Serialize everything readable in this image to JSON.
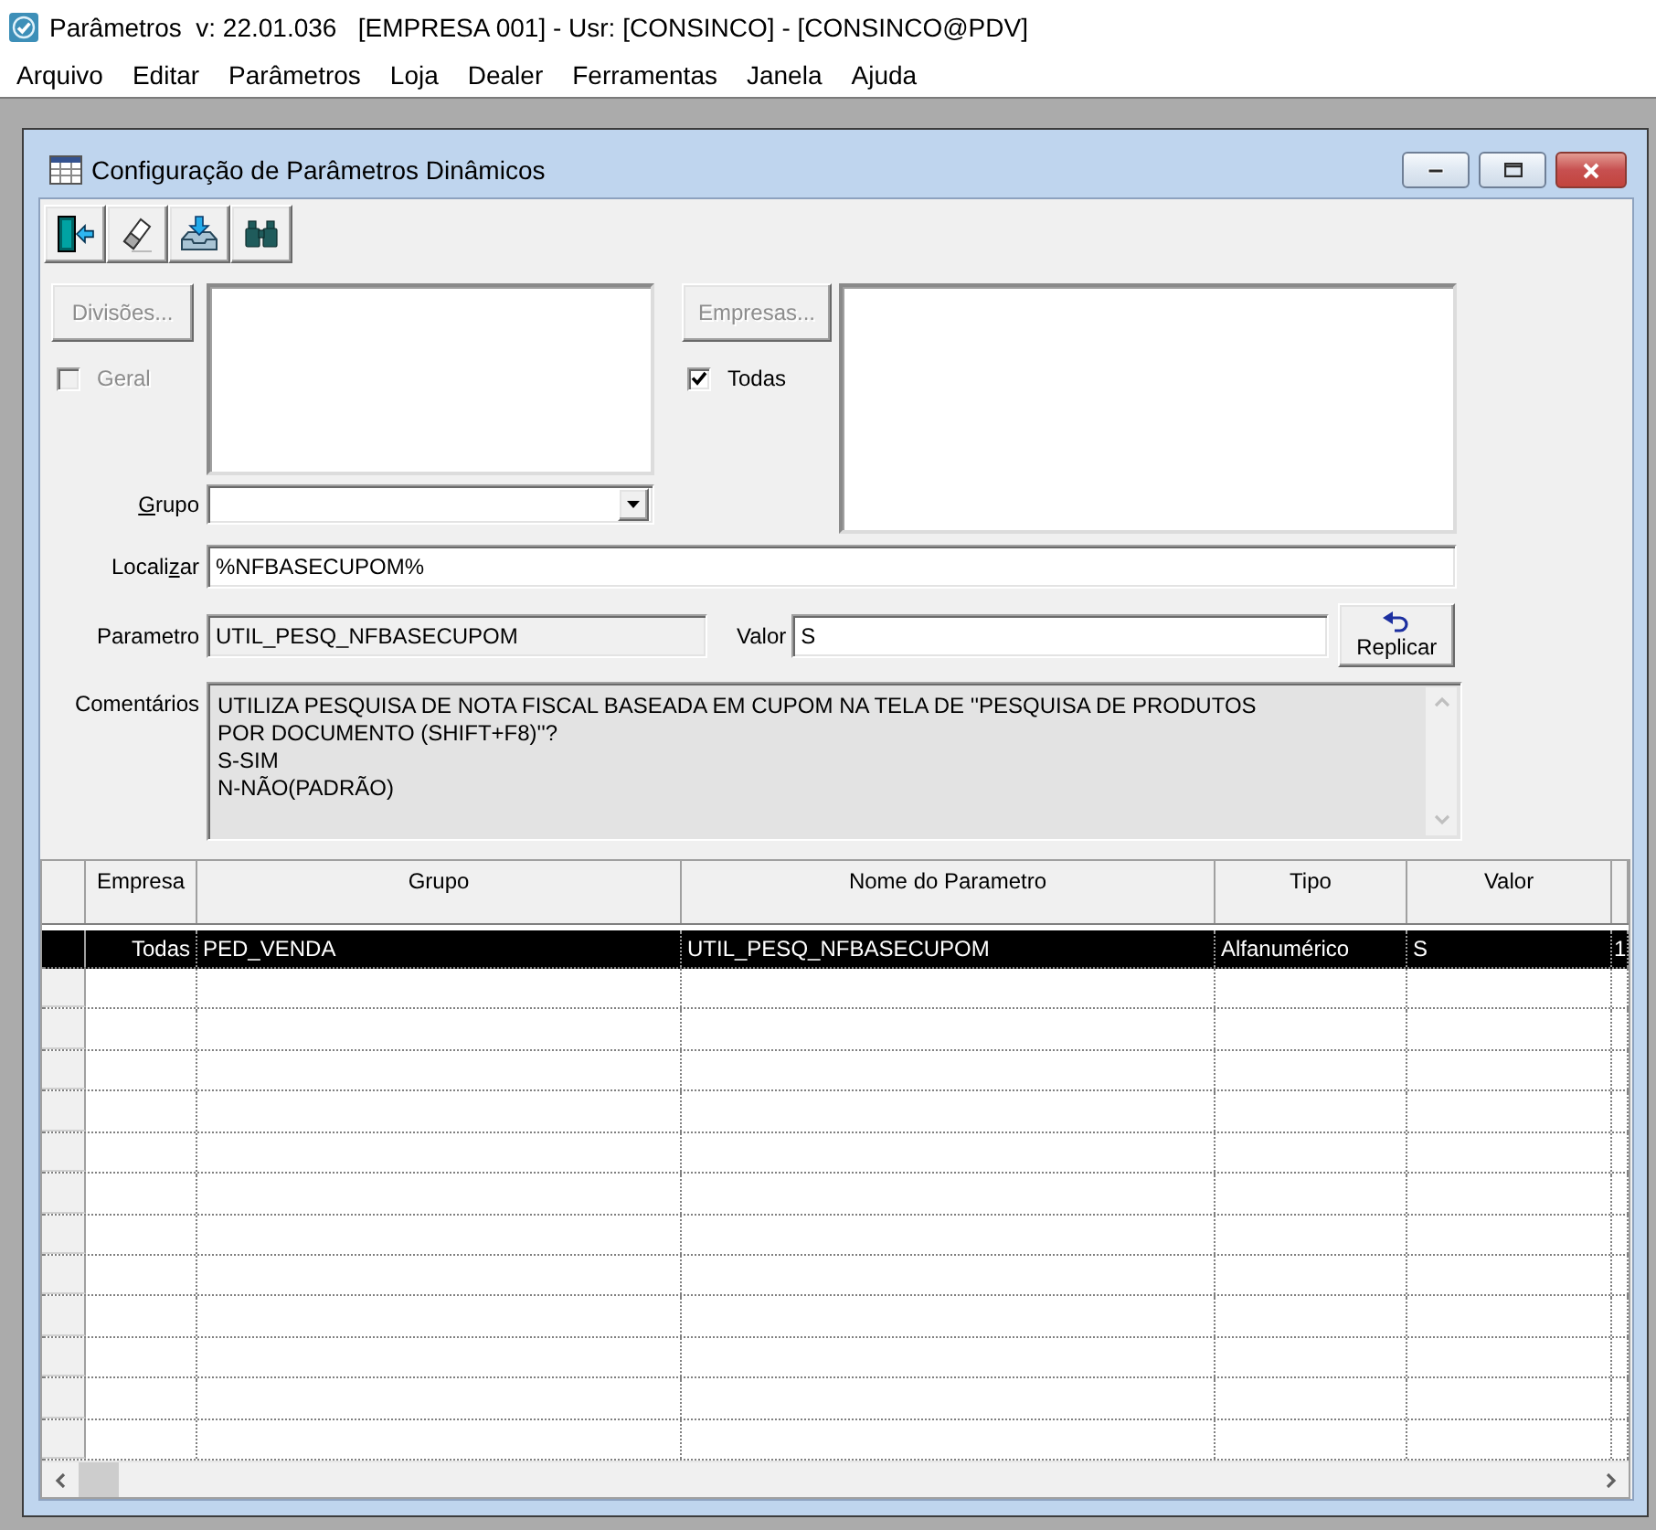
{
  "window": {
    "title": "Parâmetros  v: 22.01.036   [EMPRESA 001] - Usr: [CONSINCO] - [CONSINCO@PDV]"
  },
  "menu": [
    "Arquivo",
    "Editar",
    "Parâmetros",
    "Loja",
    "Dealer",
    "Ferramentas",
    "Janela",
    "Ajuda"
  ],
  "child_window": {
    "title": "Configuração de Parâmetros Dinâmicos"
  },
  "divisions": {
    "button": {
      "label": "Divisões...",
      "disabled": true
    },
    "all_checkbox": {
      "label": "Geral",
      "checked": false,
      "disabled": true
    }
  },
  "group": {
    "label_parts": [
      {
        "text": "G",
        "underlined": true
      },
      {
        "text": "rupo",
        "underlined": false
      }
    ]
  },
  "companies": {
    "button": {
      "label": "Empresas...",
      "disabled": true
    },
    "all_checkbox": {
      "label": "Todas",
      "checked": true,
      "disabled": false
    }
  },
  "search": {
    "label_parts": [
      {
        "text": "Locali",
        "underlined": false
      },
      {
        "text": "z",
        "underlined": true
      },
      {
        "text": "ar",
        "underlined": false
      }
    ],
    "value": "%NFBASECUPOM%"
  },
  "parameter": {
    "label": "Parametro",
    "value": "UTIL_PESQ_NFBASECUPOM",
    "read_only": true
  },
  "value_field": {
    "label": "Valor",
    "value": "S"
  },
  "replicate_button": {
    "label": "Replicar"
  },
  "comments": {
    "label": "Comentários",
    "read_only": true,
    "lines": [
      "UTILIZA PESQUISA DE NOTA FISCAL BASEADA EM CUPOM NA TELA DE ''PESQUISA DE PRODUTOS",
      "POR DOCUMENTO (SHIFT+F8)''?",
      "S-SIM",
      "N-NÃO(PADRÃO)"
    ]
  },
  "table": {
    "columns": [
      "Empresa",
      "Grupo",
      "Nome do Parametro",
      "Tipo",
      "Valor"
    ],
    "rows": [
      {
        "selected": true,
        "cells": [
          "Todas",
          "PED_VENDA",
          "UTIL_PESQ_NFBASECUPOM",
          "Alfanumérico",
          "S",
          "1"
        ]
      }
    ]
  }
}
